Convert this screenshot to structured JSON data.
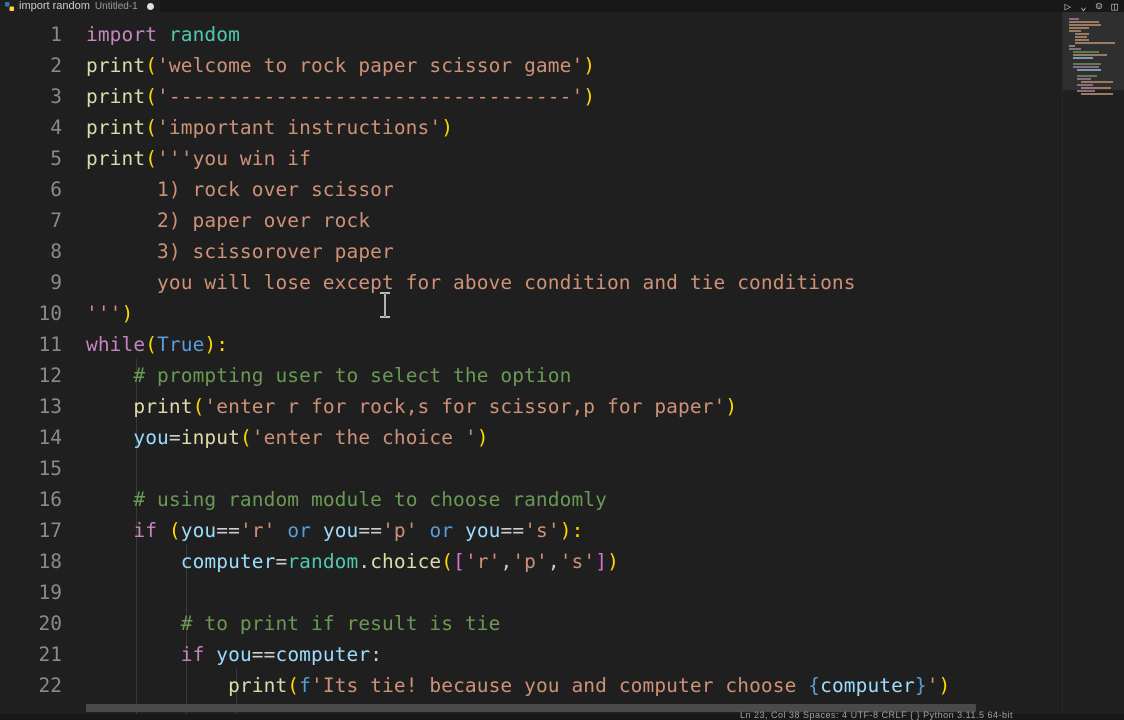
{
  "tab": {
    "filename": "import random",
    "subtitle": "Untitled-1"
  },
  "actions": {
    "run_icon": "▷",
    "dropdown_icon": "⌄",
    "copilot_icon": "☺",
    "layout_icon": "◫"
  },
  "status": {
    "text": "Ln 23, Col 38   Spaces: 4   UTF-8   CRLF   { } Python   3.11.5 64-bit"
  },
  "line_numbers": [
    "1",
    "2",
    "3",
    "4",
    "5",
    "6",
    "7",
    "8",
    "9",
    "10",
    "11",
    "12",
    "13",
    "14",
    "15",
    "16",
    "17",
    "18",
    "19",
    "20",
    "21",
    "22"
  ],
  "code": {
    "l1": [
      "import",
      " ",
      "random"
    ],
    "l2": [
      "print",
      "(",
      "'welcome to rock paper scissor game'",
      ")"
    ],
    "l3": [
      "print",
      "(",
      "'----------------------------------'",
      ")"
    ],
    "l4": [
      "print",
      "(",
      "'important instructions'",
      ")"
    ],
    "l5": [
      "print",
      "(",
      "'''you win if"
    ],
    "l6": [
      "      1) rock over scissor"
    ],
    "l7": [
      "      2) paper over rock"
    ],
    "l8": [
      "      3) scissorover paper"
    ],
    "l9": [
      "      you will lose except for above condition and tie conditions"
    ],
    "l10": [
      "'''",
      ")"
    ],
    "l11": [
      "while",
      "(",
      "True",
      "):"
    ],
    "l12": [
      "    ",
      "# prompting user to select the option"
    ],
    "l13": [
      "    ",
      "print",
      "(",
      "'enter r for rock,s for scissor,p for paper'",
      ")"
    ],
    "l14": [
      "    ",
      "you",
      "=",
      "input",
      "(",
      "'enter the choice '",
      ")"
    ],
    "l16": [
      "    ",
      "# using random module to choose randomly"
    ],
    "l17": [
      "    ",
      "if",
      " ",
      "(",
      "you",
      "==",
      "'r'",
      " ",
      "or",
      " ",
      "you",
      "==",
      "'p'",
      " ",
      "or",
      " ",
      "you",
      "==",
      "'s'",
      "):"
    ],
    "l18": [
      "        ",
      "computer",
      "=",
      "random",
      ".",
      "choice",
      "(",
      "[",
      "'r'",
      ",",
      "'p'",
      ",",
      "'s'",
      "]",
      ")"
    ],
    "l20": [
      "        ",
      "# to print if result is tie"
    ],
    "l21": [
      "        ",
      "if",
      " ",
      "you",
      "==",
      "computer",
      ":"
    ],
    "l22": [
      "            ",
      "print",
      "(",
      "f",
      "'Its tie! because you and computer choose ",
      "{",
      "computer",
      "}",
      "'",
      ")"
    ]
  },
  "colors": {
    "background": "#1f1f1f",
    "keyword": "#c586c0",
    "function": "#dcdcaa",
    "string": "#ce9178",
    "variable": "#9cdcfe",
    "comment": "#6a9955",
    "builtin": "#569cd6",
    "module": "#4ec9b0"
  }
}
